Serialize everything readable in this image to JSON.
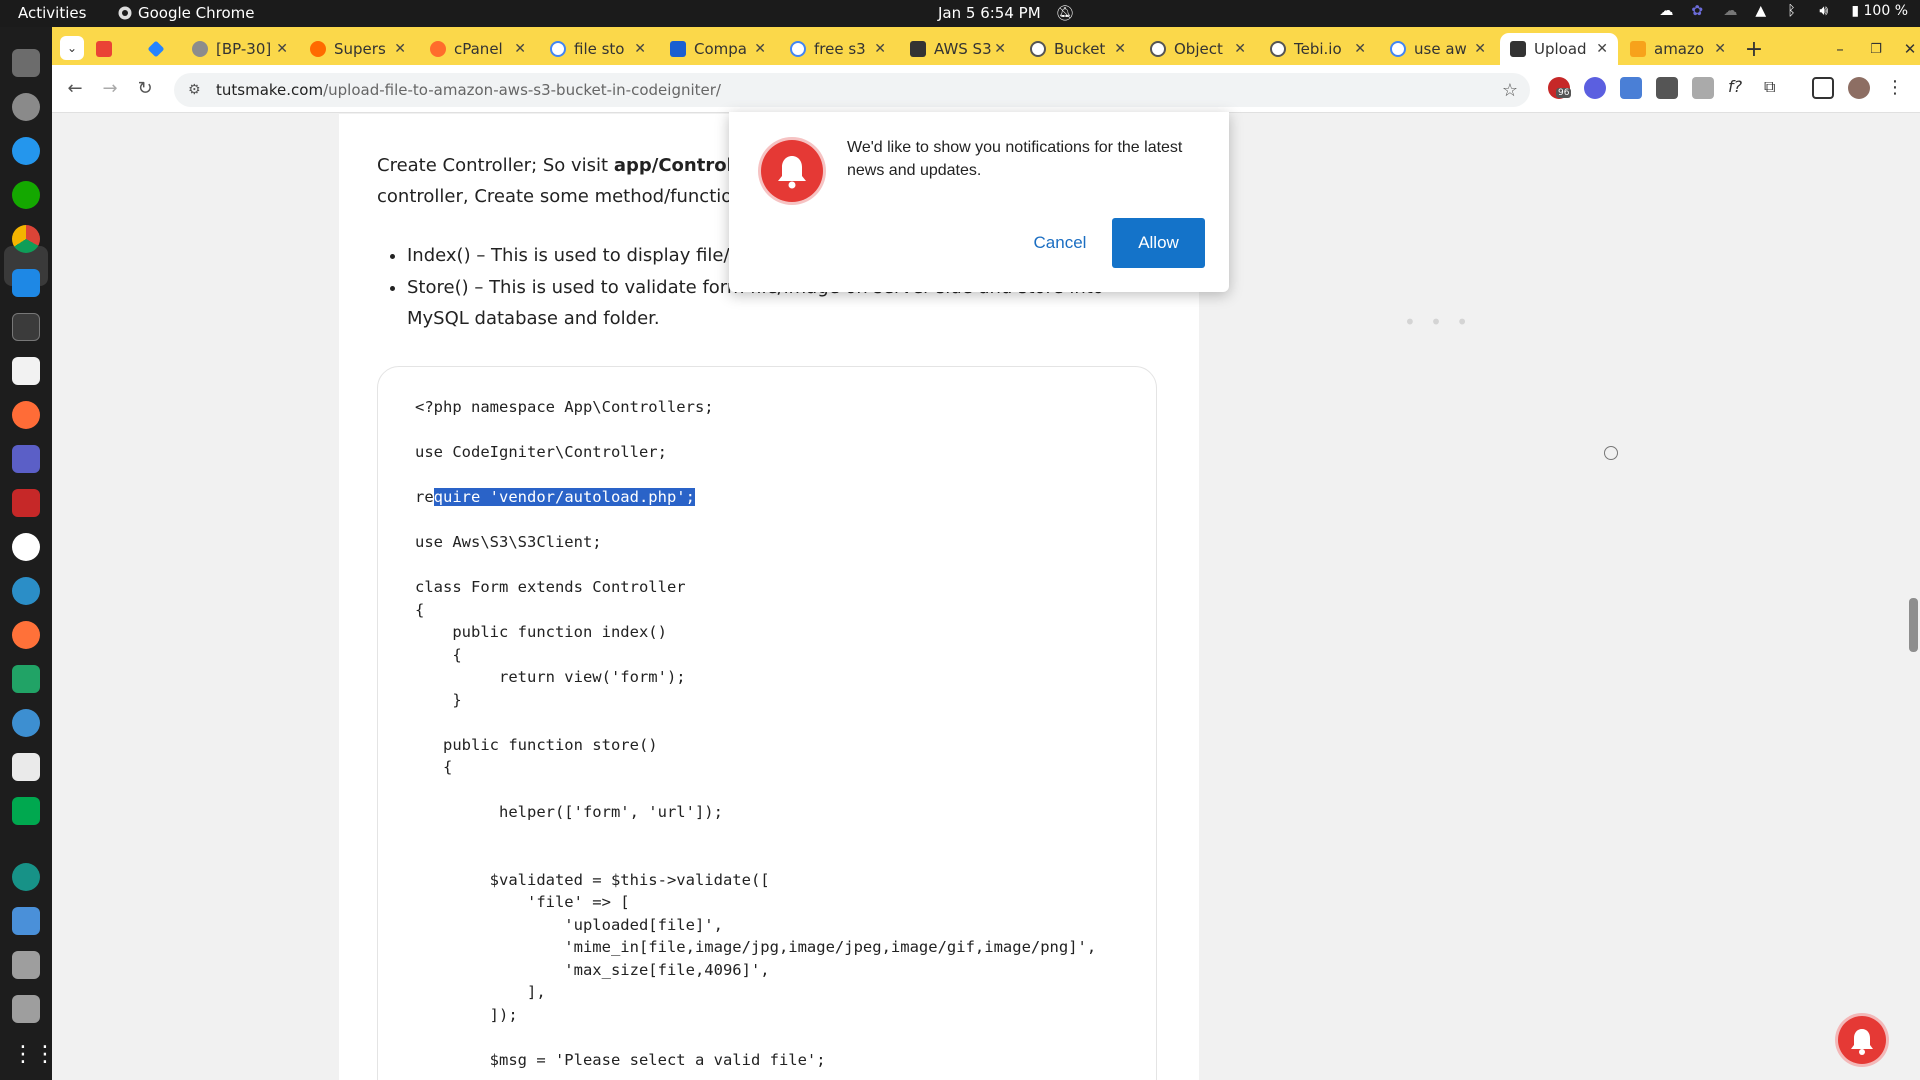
{
  "topbar": {
    "activities": "Activities",
    "app_name": "Google Chrome",
    "clock": "Jan 5   6:54 PM",
    "battery": "100 %"
  },
  "tabs": [
    {
      "label": "",
      "icon": "gmail-icon"
    },
    {
      "label": "",
      "icon": "jira-icon"
    },
    {
      "label": "[BP-30]",
      "icon": "site-icon"
    },
    {
      "label": "Supers",
      "icon": "site-icon"
    },
    {
      "label": "cPanel",
      "icon": "cpanel-icon"
    },
    {
      "label": "file sto",
      "icon": "google-icon"
    },
    {
      "label": "Compa",
      "icon": "site-icon"
    },
    {
      "label": "free s3",
      "icon": "google-icon"
    },
    {
      "label": "AWS S3",
      "icon": "site-icon"
    },
    {
      "label": "Bucket",
      "icon": "globe-icon"
    },
    {
      "label": "Object",
      "icon": "globe-icon"
    },
    {
      "label": "Tebi.io",
      "icon": "globe-icon"
    },
    {
      "label": "use aw",
      "icon": "google-icon"
    },
    {
      "label": "Upload",
      "icon": "tm-icon"
    },
    {
      "label": "amazo",
      "icon": "site-icon"
    }
  ],
  "address": {
    "domain": "tutsmake.com",
    "path": "/upload-file-to-amazon-aws-s3-bucket-in-codeigniter/"
  },
  "extension_badge": "96",
  "article": {
    "intro_1": "Create Controller; So visit ",
    "intro_bold": "app/Controllers",
    "intro_2": "controller, Create some method/function;",
    "bullets": [
      "Index() – This is used to display file/im",
      "Store() – This is used to validate form file/image on server-side and store into MySQL database and folder."
    ]
  },
  "code_lines": [
    "<?php namespace App\\Controllers;",
    "",
    "use CodeIgniter\\Controller;",
    "",
    "re|quire 'vendor/autoload.php';",
    "",
    "use Aws\\S3\\S3Client;",
    "",
    "class Form extends Controller",
    "{",
    "    public function index()",
    "    {",
    "         return view('form');",
    "    }",
    "",
    "   public function store()",
    "   {",
    "",
    "         helper(['form', 'url']);",
    "",
    "",
    "        $validated = $this->validate([",
    "            'file' => [",
    "                'uploaded[file]',",
    "                'mime_in[file,image/jpg,image/jpeg,image/gif,image/png]',",
    "                'max_size[file,4096]',",
    "            ],",
    "        ]);",
    "",
    "        $msg = 'Please select a valid file';"
  ],
  "notification": {
    "message": "We'd like to show you notifications for the latest news and updates.",
    "cancel": "Cancel",
    "allow": "Allow"
  },
  "colors": {
    "tabbar": "#fbd84a",
    "accent": "#1473c9",
    "selection": "#2a63c8",
    "bell": "#e53935"
  }
}
